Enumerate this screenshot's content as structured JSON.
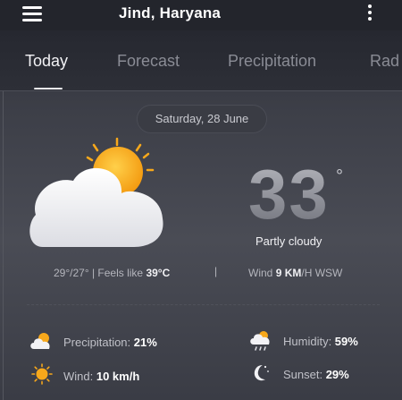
{
  "header": {
    "location": "Jind, Haryana"
  },
  "tabs": [
    {
      "label": "Today"
    },
    {
      "label": "Forecast"
    },
    {
      "label": "Precipitation"
    },
    {
      "label": "Rad"
    }
  ],
  "current": {
    "date": "Saturday, 28 June",
    "temperature": "33",
    "degree_symbol": "°",
    "condition": "Partly cloudy",
    "range_text": "29°/27° | Feels like ",
    "feels_like": "39°C",
    "separator": "|",
    "wind_prefix": "Wind ",
    "wind_value": "9 KM",
    "wind_suffix": "/H WSW"
  },
  "stats": {
    "precipitation_label": "Precipitation: ",
    "precipitation_value": "21%",
    "humidity_label": "Humidity: ",
    "humidity_value": "59%",
    "wind_label": "Wind: ",
    "wind_value": "10 km/h",
    "sunset_label": "Sunset: ",
    "sunset_value": "29%"
  },
  "icons": {
    "menu": "hamburger-menu-icon",
    "more": "kebab-menu-icon",
    "main_weather": "partly-cloudy-icon",
    "precipitation": "cloud-sun-icon",
    "humidity": "rain-cloud-icon",
    "wind": "sun-icon",
    "sunset": "moon-stars-icon"
  },
  "colors": {
    "sun": "#f7a81b",
    "background_top": "#2c2e36",
    "background_bottom": "#3a3c45",
    "text_primary": "#ffffff",
    "tab_inactive": "#8a8c95"
  }
}
